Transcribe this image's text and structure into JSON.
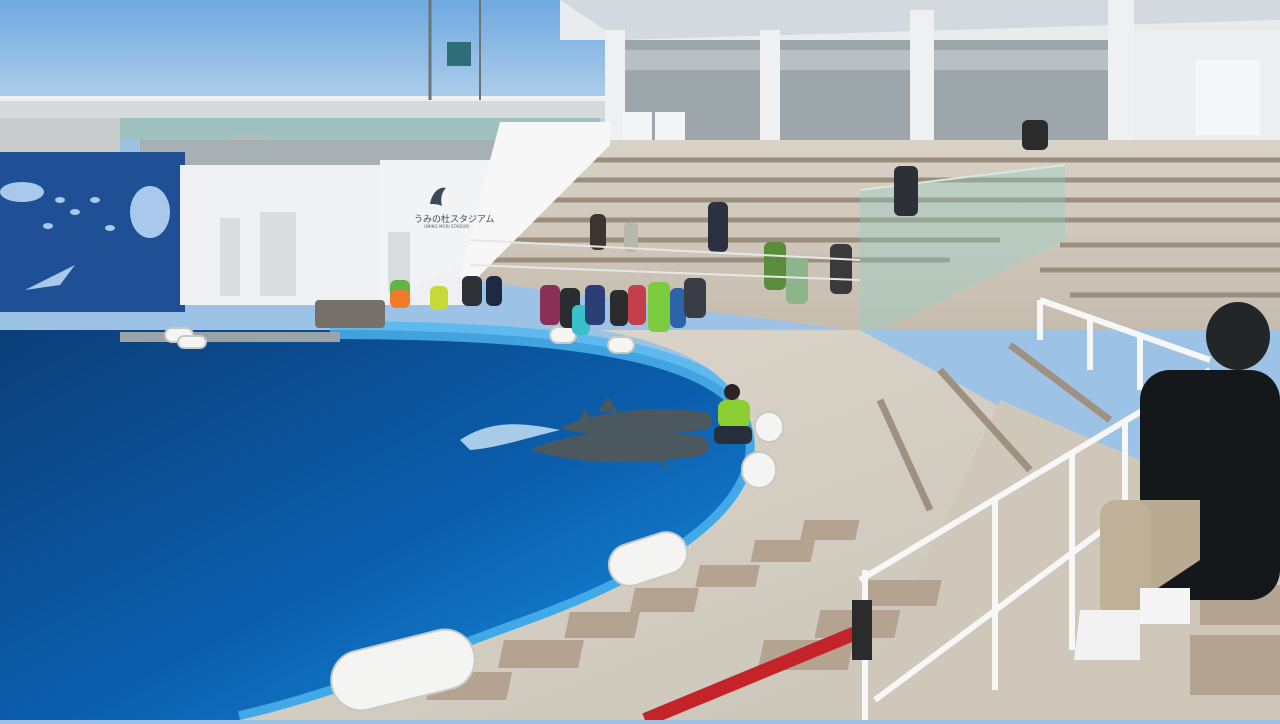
{
  "scene": {
    "description_tag": "dolphin-stadium-photo",
    "stadium_sign": "うみの杜スタジアム",
    "stadium_sign_sub": "UMINO MORI STADIUM"
  },
  "colors": {
    "sky": "#8fbde6",
    "pool_deep": "#0a4f96",
    "pool_edge": "#1a8be0",
    "deck": "#e6e1d8",
    "seats": "#b9a893",
    "railing": "#f4f4f4",
    "rope": "#c4232a",
    "mural": "#1f4f94"
  },
  "icons": [
    "dolphin-logo-icon"
  ]
}
